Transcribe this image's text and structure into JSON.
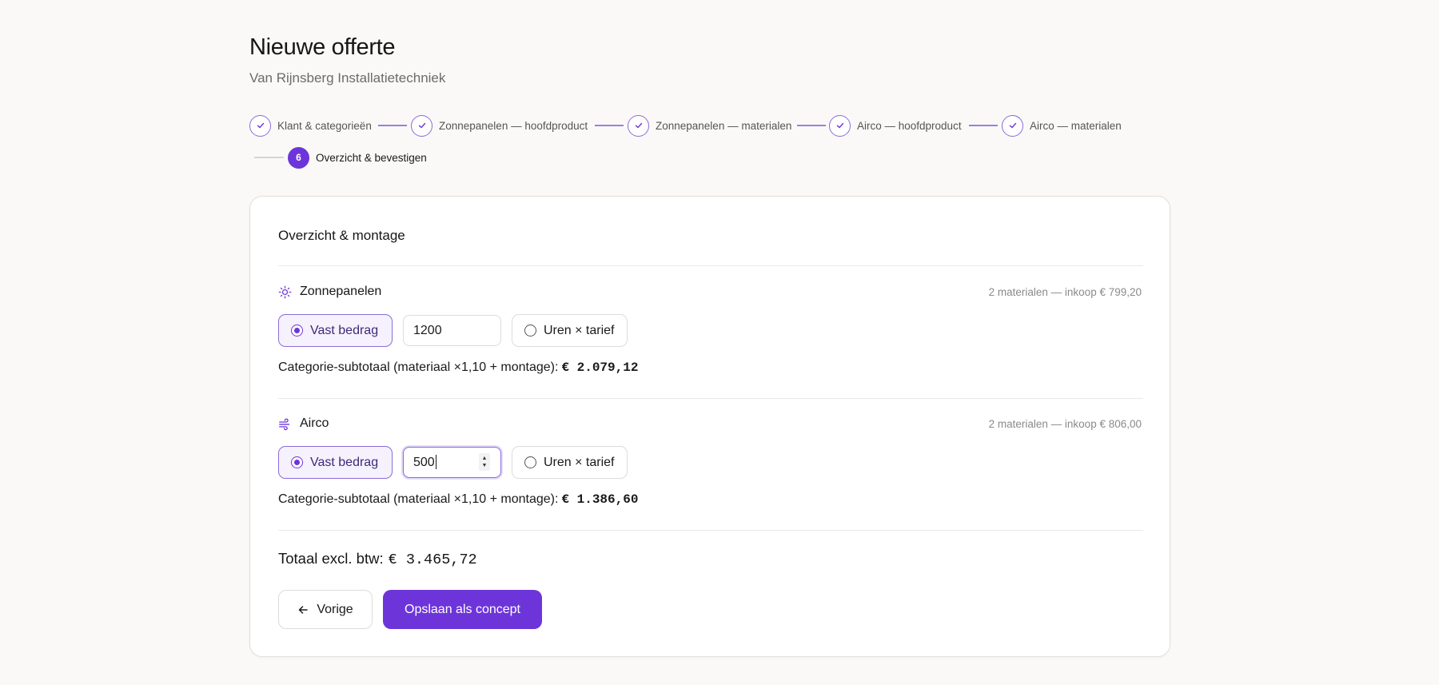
{
  "header": {
    "title": "Nieuwe offerte",
    "subtitle": "Van Rijnsberg Installatietechniek"
  },
  "stepper": {
    "steps": [
      {
        "label": "Klant & categorieën",
        "state": "done"
      },
      {
        "label": "Zonnepanelen — hoofdproduct",
        "state": "done"
      },
      {
        "label": "Zonnepanelen — materialen",
        "state": "done"
      },
      {
        "label": "Airco — hoofdproduct",
        "state": "done"
      },
      {
        "label": "Airco — materialen",
        "state": "done"
      },
      {
        "label": "Overzicht & bevestigen",
        "state": "active",
        "number": "6"
      }
    ]
  },
  "card": {
    "title": "Overzicht & montage",
    "categories": [
      {
        "name": "Zonnepanelen",
        "icon": "sun-icon",
        "meta": "2 materialen — inkoop € 799,20",
        "option_fixed": "Vast bedrag",
        "option_hourly": "Uren × tarief",
        "selected": "fixed",
        "amount": "1200",
        "subtotal_label": "Categorie-subtotaal (materiaal ×1,10 + montage):",
        "subtotal_value": "€ 2.079,12"
      },
      {
        "name": "Airco",
        "icon": "wind-icon",
        "meta": "2 materialen — inkoop € 806,00",
        "option_fixed": "Vast bedrag",
        "option_hourly": "Uren × tarief",
        "selected": "fixed",
        "amount": "500",
        "subtotal_label": "Categorie-subtotaal (materiaal ×1,10 + montage):",
        "subtotal_value": "€ 1.386,60"
      }
    ],
    "total_label": "Totaal excl. btw:",
    "total_value": "€ 3.465,72",
    "prev_button": "Vorige",
    "save_button": "Opslaan als concept"
  },
  "colors": {
    "accent": "#6d35d9",
    "accent_light": "#f5f1fd",
    "background": "#faf9f7"
  }
}
